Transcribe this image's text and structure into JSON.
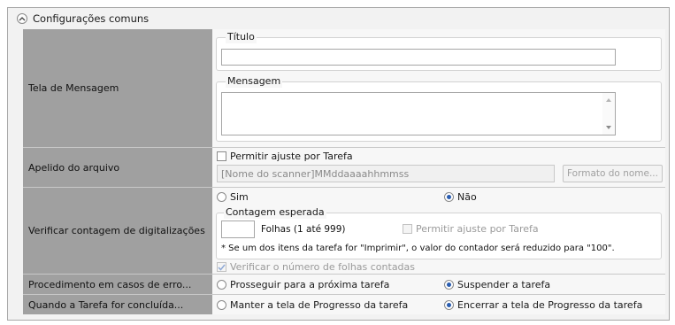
{
  "header": {
    "title": "Configurações comuns",
    "collapse_icon": "chevron-up-circle-icon"
  },
  "rows": {
    "message": {
      "label": "Tela de Mensagem",
      "title_group": "Título",
      "title_value": "",
      "message_group": "Mensagem",
      "message_value": ""
    },
    "file_alias": {
      "label": "Apelido do arquivo",
      "allow_adjust_label": "Permitir ajuste por Tarefa",
      "allow_adjust_checked": false,
      "name_value": "[Nome do scanner]MMddaaaahhmmss",
      "format_button": "Formato do nome..."
    },
    "scan_count": {
      "label": "Verificar contagem de digitalizações",
      "option_yes": "Sim",
      "option_no": "Não",
      "selected": "Não",
      "expected_group": "Contagem esperada",
      "sheets_value": "",
      "sheets_label": "Folhas (1 até 999)",
      "allow_adjust_label": "Permitir ajuste por Tarefa",
      "note": "* Se um dos itens da tarefa for \"Imprimir\", o valor do contador será reduzido para \"100\".",
      "verify_label": "Verificar o número de folhas contadas",
      "verify_checked": true
    },
    "error_procedure": {
      "label": "Procedimento em casos de erro...",
      "option_continue": "Prosseguir para a próxima tarefa",
      "option_suspend": "Suspender a tarefa",
      "selected": "Suspender a tarefa"
    },
    "on_complete": {
      "label": "Quando a Tarefa for concluída...",
      "option_keep": "Manter a tela de Progresso da tarefa",
      "option_close": "Encerrar a tela de Progresso da tarefa",
      "selected": "Encerrar a tela de Progresso da tarefa"
    }
  },
  "colors": {
    "label_bg": "#a0a0a0",
    "panel_bg": "#f2f2f2",
    "radio_dot": "#2a5db0"
  }
}
